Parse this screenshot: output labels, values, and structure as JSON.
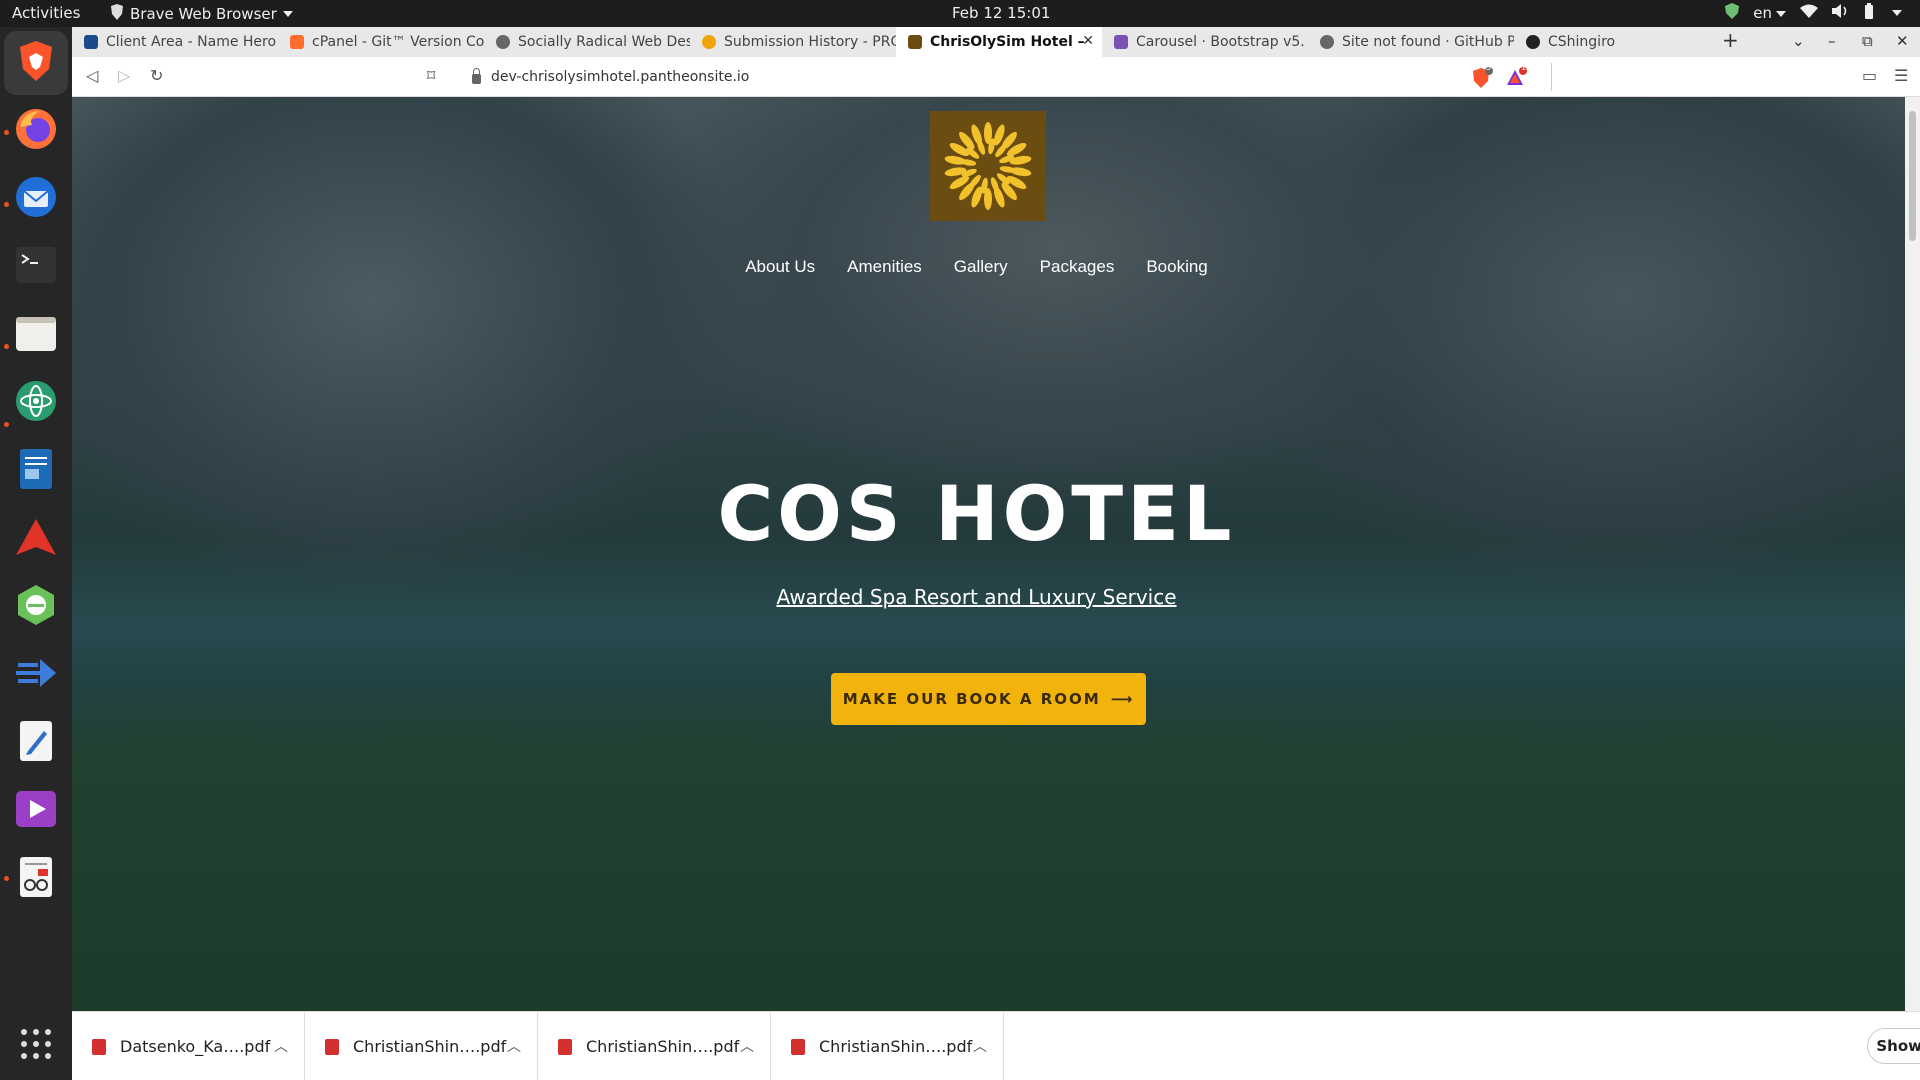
{
  "topbar": {
    "activities": "Activities",
    "app_name": "Brave Web Browser",
    "clock": "Feb 12  15:01",
    "lang": "en"
  },
  "dock": {
    "apps": [
      "brave-icon",
      "firefox-icon",
      "thunderbird-icon",
      "terminal-icon",
      "files-icon",
      "atom-icon",
      "document-viewer-icon",
      "app-a-icon",
      "app-e-icon",
      "app-arrow-icon",
      "text-editor-icon",
      "video-player-icon",
      "screen-reader-icon"
    ]
  },
  "tabs": [
    {
      "label": "Client Area - Name Hero",
      "color": "#1a4a8a"
    },
    {
      "label": "cPanel - Git™ Version Co",
      "color": "#ff6c2c"
    },
    {
      "label": "Socially Radical Web Des",
      "color": "#666666"
    },
    {
      "label": "Submission History - PRO",
      "color": "#f2a20c"
    },
    {
      "label": "ChrisOlySim Hotel – ",
      "color": "#6b4d12"
    },
    {
      "label": "Carousel · Bootstrap v5.",
      "color": "#7952b3"
    },
    {
      "label": "Site not found · GitHub P",
      "color": "#666666"
    },
    {
      "label": "CShingiro",
      "color": "#222222"
    }
  ],
  "address": {
    "url": "dev-chrisolysimhotel.pantheonsite.io",
    "brave_badge": "5",
    "rewards_badge": "1"
  },
  "site": {
    "nav": [
      "About Us",
      "Amenities",
      "Gallery",
      "Packages",
      "Booking"
    ],
    "title": "COS HOTEL",
    "subtitle": "Awarded Spa Resort and Luxury Service",
    "cta": "MAKE OUR BOOK A ROOM"
  },
  "downloads": {
    "items": [
      "Datsenko_Ka….pdf",
      "ChristianShin….pdf",
      "ChristianShin….pdf",
      "ChristianShin….pdf"
    ],
    "show_all": "Show all"
  },
  "colors": {
    "accent": "#f2b40c",
    "logo_bg": "#6b4d12"
  }
}
